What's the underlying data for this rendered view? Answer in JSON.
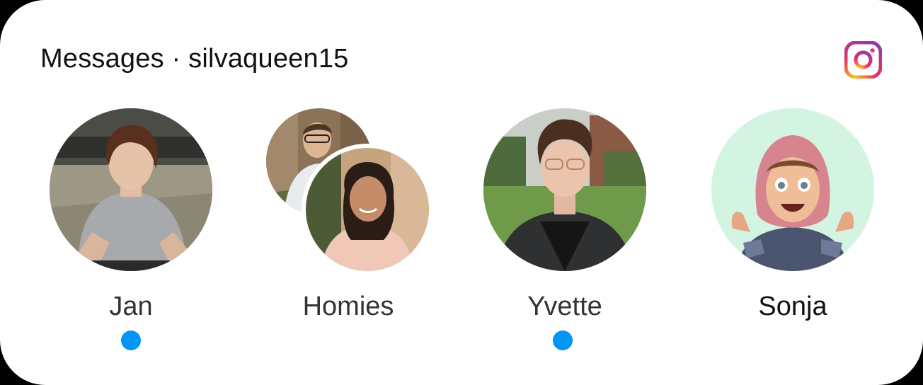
{
  "widget": {
    "title": "Messages · silvaqueen15",
    "accent_color": "#0095f6",
    "logo_icon": "instagram-logo-icon"
  },
  "contacts": [
    {
      "name": "Jan",
      "unread": true,
      "avatar": "photo-young-man-grey-shirt"
    },
    {
      "name": "Homies",
      "unread": false,
      "avatar": "group-two-photos"
    },
    {
      "name": "Yvette",
      "unread": true,
      "avatar": "photo-person-glasses-leather-jacket"
    },
    {
      "name": "Sonja",
      "unread": false,
      "avatar": "avatar-hijab-cartoon"
    }
  ]
}
